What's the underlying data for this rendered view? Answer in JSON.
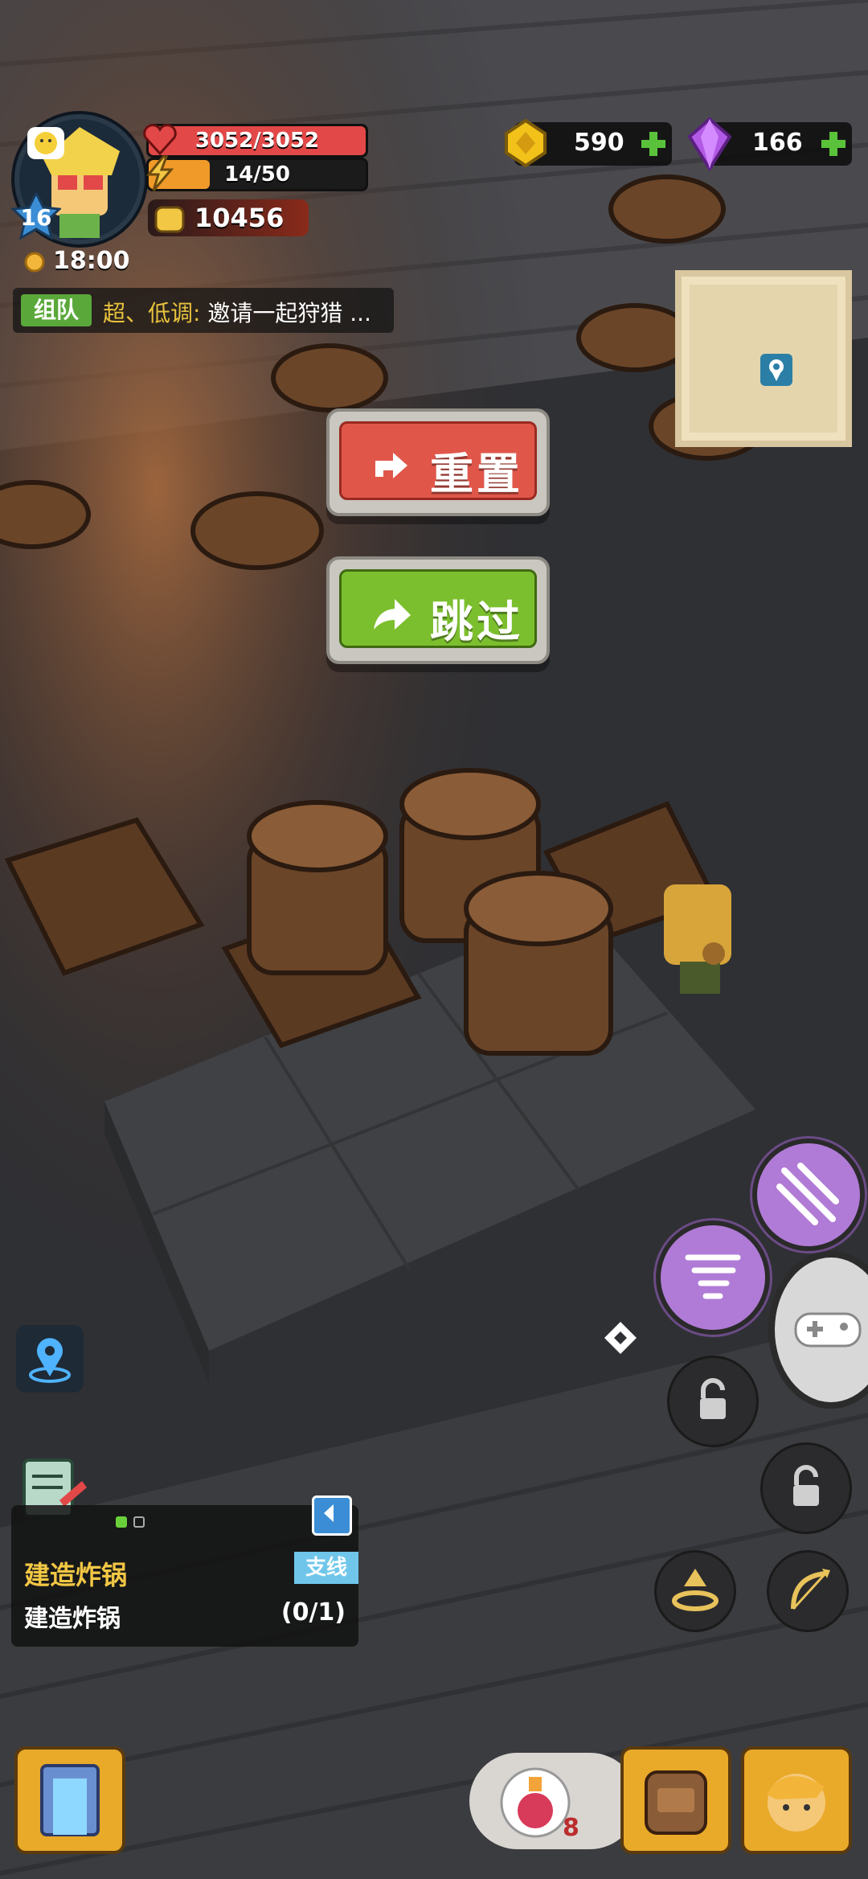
{
  "player": {
    "level": "16",
    "hp": "3052/3052",
    "hp_fraction": 1.0,
    "energy": "14/50",
    "energy_fraction": 0.28,
    "fame": "10456",
    "time": "18:00"
  },
  "currency": {
    "gold": "590",
    "gems": "166"
  },
  "team": {
    "tag": "组队",
    "highlight": "超、低调:",
    "message": "邀请一起狩猎 ..."
  },
  "buttons": {
    "reset": "重置",
    "skip": "跳过"
  },
  "quest": {
    "title": "建造炸锅",
    "tag": "支线",
    "task": "建造炸锅",
    "progress": "(0/1)"
  },
  "inventory": {
    "potion_count": "8"
  },
  "colors": {
    "reset_red": "#e0574a",
    "skip_green": "#7cbf2e",
    "skill_purple": "#b07bd6",
    "hp_red": "#e24848",
    "energy_orange": "#f09a2a"
  }
}
